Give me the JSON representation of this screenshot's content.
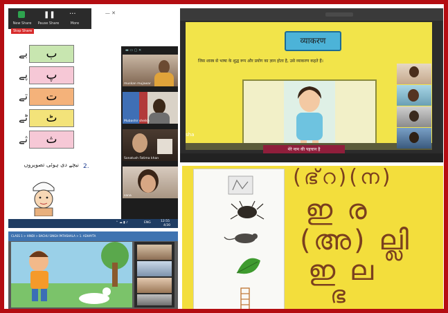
{
  "zoom_controls": {
    "new_share": "New Share",
    "pause_share": "Pause Share",
    "more": "More",
    "stop_share": "Stop Share"
  },
  "urdu_sheet": {
    "letters": [
      "ب",
      "پ",
      "ت",
      "ٹ",
      "ث"
    ],
    "left_glyphs": [
      "بے",
      "پے",
      "تے",
      "ٹے",
      "ثے"
    ],
    "letter_colors": [
      "#c8e6b0",
      "#f6c8d6",
      "#f4b27a",
      "#f3e37a",
      "#f6c8d6"
    ],
    "question_number": "2.",
    "question_text": "نیچے دی ہوئی تصویروں",
    "participants": [
      {
        "name": "muskan mujawar"
      },
      {
        "name": "Mubashir sheikh"
      },
      {
        "name": "Sonatush Fatima khan"
      },
      {
        "name": "sana"
      }
    ],
    "taskbar_lang": "ENG",
    "clock_time": "12:55",
    "clock_date": "4/30"
  },
  "hindi_slide": {
    "heading": "व्याकरण",
    "definition": "जिस शास्त्र से भाषा के शुद्ध रूप और प्रयोग का ज्ञान होता है, उसे व्याकरण कहते हैं।",
    "caption": "मेरे नाम की पहचान है",
    "speaker_name": "sha"
  },
  "cartoon_lesson": {
    "toolbar_text": "CLASS 1 > HINDI > BACHU SINGH PATHSHALA > 1. ADHAYTA"
  },
  "malayalam_board": {
    "lines": [
      "(ഭ്‌റ)(ന)",
      "ഇ ര",
      "(അ) ല്ലി",
      "ഇ ല",
      "ഭ"
    ]
  }
}
